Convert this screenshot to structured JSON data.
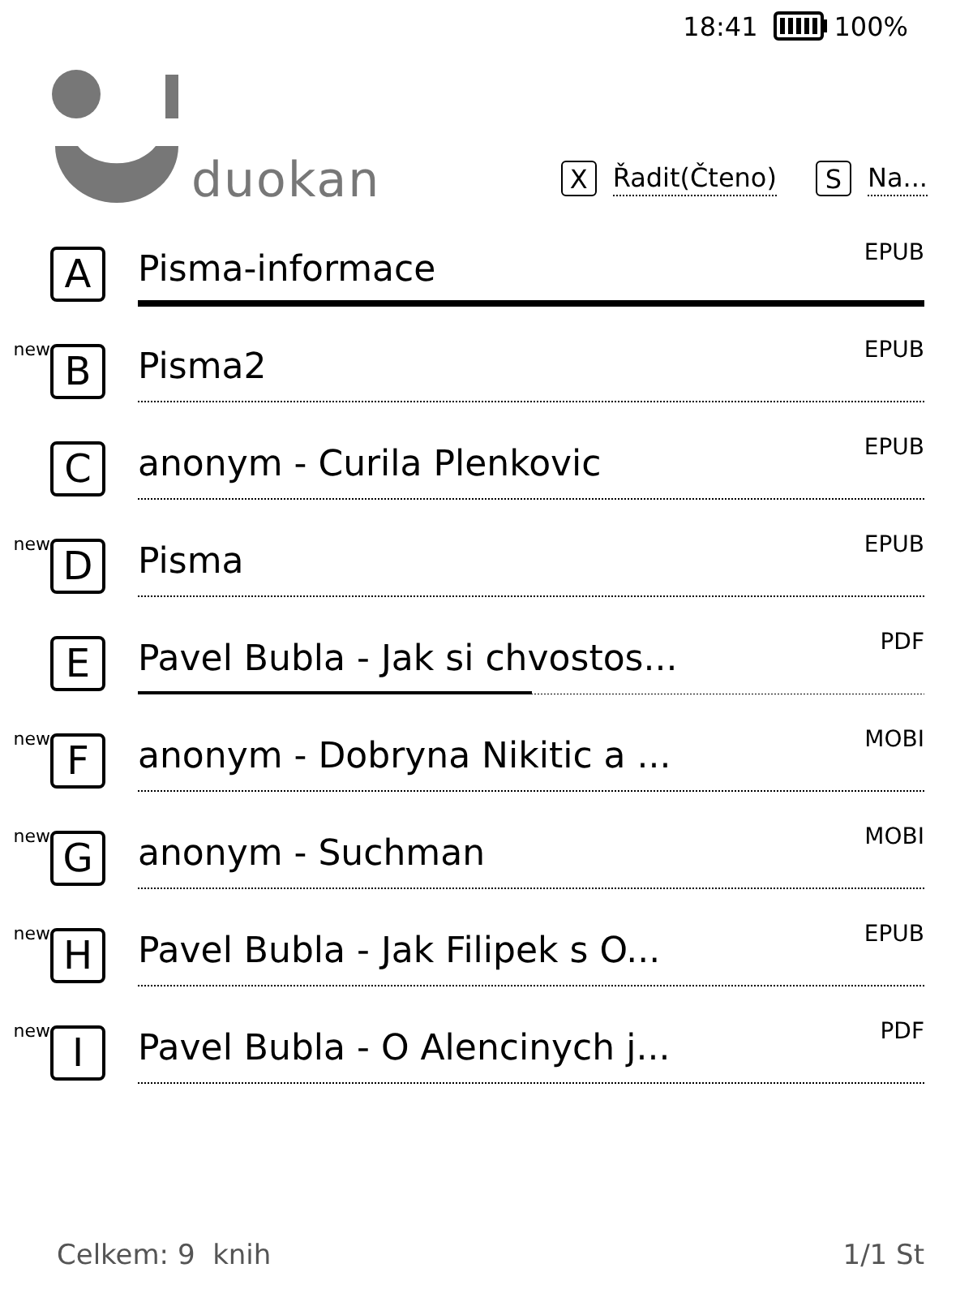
{
  "status_bar": {
    "time": "18:41",
    "battery": "100%"
  },
  "logo": {
    "text": "duokan"
  },
  "toolbar": [
    {
      "key": "X",
      "label": "Řadit(Čteno)"
    },
    {
      "key": "S",
      "label": "Na..."
    }
  ],
  "books": [
    {
      "key": "A",
      "title": "Pisma-informace",
      "format": "EPUB",
      "selected": true
    },
    {
      "badge": "new",
      "key": "B",
      "title": "Pisma2",
      "format": "EPUB",
      "selected": false
    },
    {
      "key": "C",
      "title": "anonym - Curila Plenkovic",
      "format": "EPUB",
      "selected": false
    },
    {
      "badge": "new",
      "key": "D",
      "title": "Pisma",
      "format": "EPUB",
      "selected": false
    },
    {
      "key": "E",
      "title": "Pavel Bubla - Jak si chvostos...",
      "format": "PDF",
      "selected": false,
      "level": 0.5
    },
    {
      "badge": "new",
      "key": "F",
      "title": "anonym - Dobryna Nikitic a ...",
      "format": "MOBI",
      "selected": false
    },
    {
      "badge": "new",
      "key": "G",
      "title": "anonym - Suchman",
      "format": "MOBI",
      "selected": false
    },
    {
      "badge": "new",
      "key": "H",
      "title": "Pavel Bubla - Jak Filipek s O...",
      "format": "EPUB",
      "selected": false
    },
    {
      "badge": "new",
      "key": "I",
      "title": "Pavel Bubla - O Alencinych j...",
      "format": "PDF",
      "selected": false
    }
  ],
  "footer": {
    "total": "Celkem: 9  knih",
    "page": "1/1 St"
  }
}
